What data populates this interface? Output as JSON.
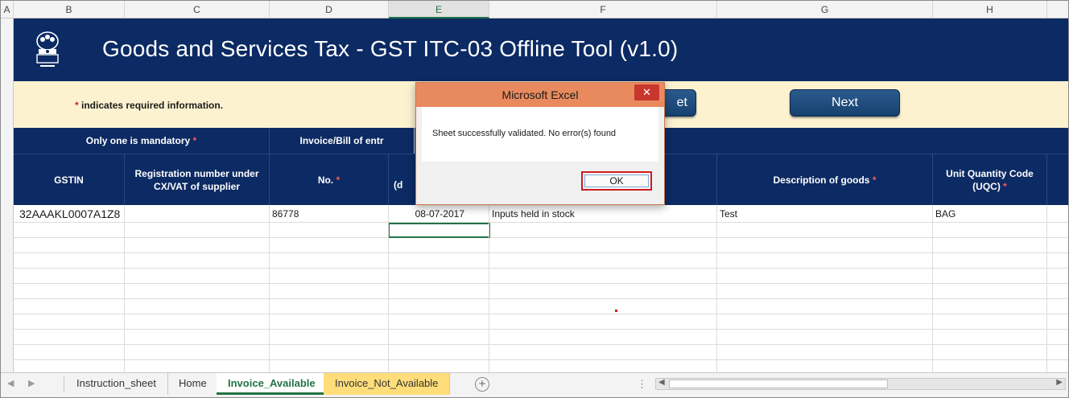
{
  "column_headers": [
    "A",
    "B",
    "C",
    "D",
    "E",
    "F",
    "G",
    "H"
  ],
  "active_column": "E",
  "banner": {
    "title": "Goods and Services Tax - GST ITC-03 Offline Tool (v1.0)",
    "emblem_icon": "ashoka-emblem-icon"
  },
  "info_bar": {
    "required_star": "*",
    "required_note": "indicates required information.",
    "prev_button_label": "et",
    "next_button_label": "Next"
  },
  "header_band": {
    "only_one_mandatory": "Only one is mandatory",
    "invoice_bill_partial": "Invoice/Bill of entr"
  },
  "table_headers": {
    "gstin": "GSTIN",
    "registration": "Registration number under CX/VAT of supplier",
    "invoice_no": "No.",
    "date_partial": "(d",
    "description": "Description of goods",
    "uqc": "Unit Quantity Code (UQC)",
    "star": "*"
  },
  "rows": [
    {
      "gstin": "32AAAKL0007A1Z8",
      "registration": "",
      "invoice_no": "86778",
      "date": "08-07-2017",
      "type": "Inputs held in stock",
      "description": "Test",
      "uqc": "BAG"
    }
  ],
  "dialog": {
    "title": "Microsoft Excel",
    "close_icon": "close-icon",
    "message": "Sheet successfully validated. No error(s) found",
    "ok_label": "OK"
  },
  "sheet_tabs": {
    "items": [
      "Instruction_sheet",
      "Home",
      "Invoice_Available",
      "Invoice_Not_Available"
    ],
    "active": "Invoice_Available",
    "add_icon": "plus-circle-icon"
  },
  "colors": {
    "navy": "#0c2a63",
    "cream": "#fdf2d0",
    "excel_green": "#217346",
    "dialog_title": "#e98a5e",
    "ok_highlight": "#d01a1a",
    "tab_yellow": "#ffdd7a"
  }
}
